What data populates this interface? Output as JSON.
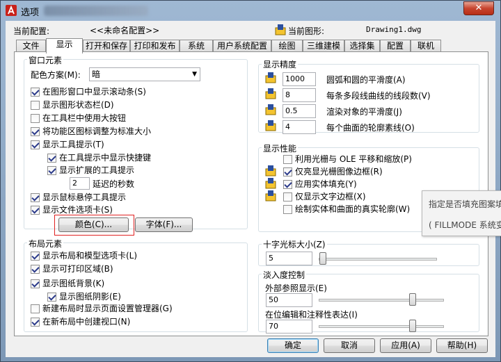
{
  "window": {
    "title": "选项",
    "close_label": "✕"
  },
  "header": {
    "profile_label": "当前配置:",
    "profile_value": "<<未命名配置>>",
    "drawing_label": "当前图形:",
    "drawing_value": "Drawing1.dwg"
  },
  "tabs": [
    {
      "label": "文件"
    },
    {
      "label": "显示"
    },
    {
      "label": "打开和保存"
    },
    {
      "label": "打印和发布"
    },
    {
      "label": "系统"
    },
    {
      "label": "用户系统配置"
    },
    {
      "label": "绘图"
    },
    {
      "label": "三维建模"
    },
    {
      "label": "选择集"
    },
    {
      "label": "配置"
    },
    {
      "label": "联机"
    }
  ],
  "active_tab": "显示",
  "window_elements": {
    "title": "窗口元素",
    "color_scheme_label": "配色方案(M):",
    "color_scheme_value": "暗",
    "checkboxes": [
      {
        "label": "在图形窗口中显示滚动条(S)",
        "checked": true
      },
      {
        "label": "显示图形状态栏(D)",
        "checked": false
      },
      {
        "label": "在工具栏中使用大按钮",
        "checked": false
      },
      {
        "label": "将功能区图标调整为标准大小",
        "checked": true
      },
      {
        "label": "显示工具提示(T)",
        "checked": true
      },
      {
        "label": "在工具提示中显示快捷键",
        "checked": true
      },
      {
        "label": "显示扩展的工具提示",
        "checked": true
      },
      {
        "label": "显示鼠标悬停工具提示",
        "checked": true
      },
      {
        "label": "显示文件选项卡(S)",
        "checked": true
      }
    ],
    "delay_value": "2",
    "delay_label": "延迟的秒数",
    "colors_button": "颜色(C)...",
    "fonts_button": "字体(F)..."
  },
  "layout_elements": {
    "title": "布局元素",
    "checkboxes": [
      {
        "label": "显示布局和模型选项卡(L)",
        "checked": true
      },
      {
        "label": "显示可打印区域(B)",
        "checked": true
      },
      {
        "label": "显示图纸背景(K)",
        "checked": true
      },
      {
        "label": "显示图纸阴影(E)",
        "checked": true
      },
      {
        "label": "新建布局时显示页面设置管理器(G)",
        "checked": false
      },
      {
        "label": "在新布局中创建视口(N)",
        "checked": true
      }
    ]
  },
  "display_resolution": {
    "title": "显示精度",
    "items": [
      {
        "value": "1000",
        "label": "圆弧和圆的平滑度(A)"
      },
      {
        "value": "8",
        "label": "每条多段线曲线的线段数(V)"
      },
      {
        "value": "0.5",
        "label": "渲染对象的平滑度(J)"
      },
      {
        "value": "4",
        "label": "每个曲面的轮廓素线(O)"
      }
    ]
  },
  "display_performance": {
    "title": "显示性能",
    "checkboxes": [
      {
        "label": "利用光栅与 OLE 平移和缩放(P)",
        "checked": false
      },
      {
        "label": "仅亮显光栅图像边框(R)",
        "checked": true
      },
      {
        "label": "应用实体填充(Y)",
        "checked": true
      },
      {
        "label": "仅显示文字边框(X)",
        "checked": false
      },
      {
        "label": "绘制实体和曲面的真实轮廓(W)",
        "checked": false
      }
    ]
  },
  "crosshair": {
    "title": "十字光标大小(Z)",
    "value": "5",
    "level_percent": 5
  },
  "fade_control": {
    "title": "淡入度控制",
    "xref_label": "外部参照显示(E)",
    "xref_value": "50",
    "inplace_label": "在位编辑和注释性表达(I)",
    "inplace_value": "70"
  },
  "tooltip": {
    "line1": "指定是否填充图案填",
    "line2": "( FILLMODE 系统变"
  },
  "footer": {
    "ok": "确定",
    "cancel": "取消",
    "apply": "应用(A)",
    "help": "帮助(H)"
  }
}
